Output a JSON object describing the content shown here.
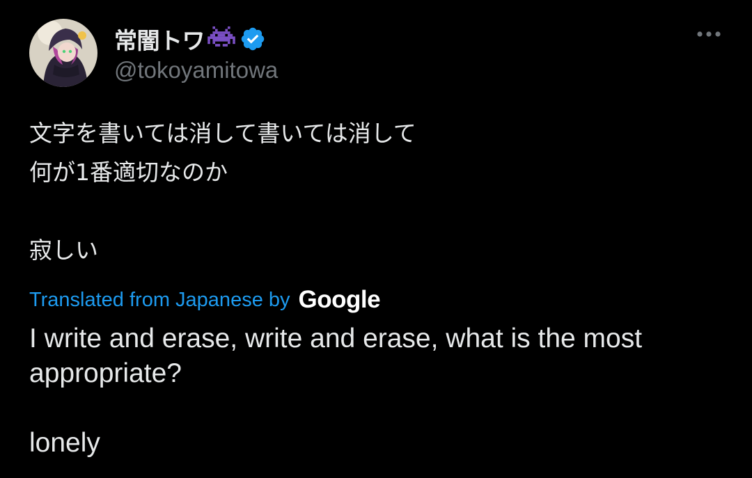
{
  "author": {
    "display_name": "常闇トワ",
    "handle": "@tokoyamitowa",
    "emoji_icon": "space-invader-icon",
    "verified": true
  },
  "menu": {
    "more_icon": "more-horizontal-icon"
  },
  "post": {
    "text": "文字を書いては消して書いては消して\n何が1番適切なのか\n\n寂しい"
  },
  "translation": {
    "label": "Translated from Japanese by",
    "provider": "Google",
    "text": "I write and erase, write and erase, what is the most\nappropriate?\n\nlonely"
  },
  "colors": {
    "background": "#000000",
    "primary_text": "#e7e9ea",
    "secondary_text": "#71767b",
    "accent": "#1d9bf0"
  }
}
